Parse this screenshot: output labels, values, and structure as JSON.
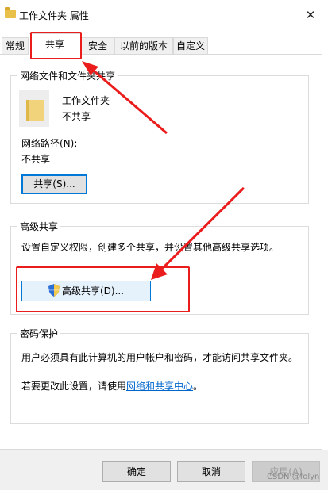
{
  "window": {
    "title": "工作文件夹 属性",
    "close_glyph": "✕"
  },
  "tabs": [
    "常规",
    "共享",
    "安全",
    "以前的版本",
    "自定义"
  ],
  "network_share": {
    "group_title": "网络文件和文件夹共享",
    "folder_name": "工作文件夹",
    "folder_status": "不共享",
    "path_label": "网络路径(N):",
    "path_value": "不共享",
    "share_button": "共享(S)..."
  },
  "advanced_share": {
    "group_title": "高级共享",
    "description": "设置自定义权限，创建多个共享，并设置其他高级共享选项。",
    "button": "高级共享(D)..."
  },
  "password": {
    "group_title": "密码保护",
    "description": "用户必须具有此计算机的用户帐户和密码，才能访问共享文件夹。",
    "change_prefix": "若要更改此设置，请使用",
    "link_text": "网络和共享中心",
    "change_suffix": "。"
  },
  "footer": {
    "ok": "确定",
    "cancel": "取消",
    "apply": "应用(A)"
  },
  "watermark": "CSDN @folyn",
  "colors": {
    "annotation_red": "#ea1c1c",
    "accent": "#0078d7",
    "folder": "#e8c04a"
  }
}
